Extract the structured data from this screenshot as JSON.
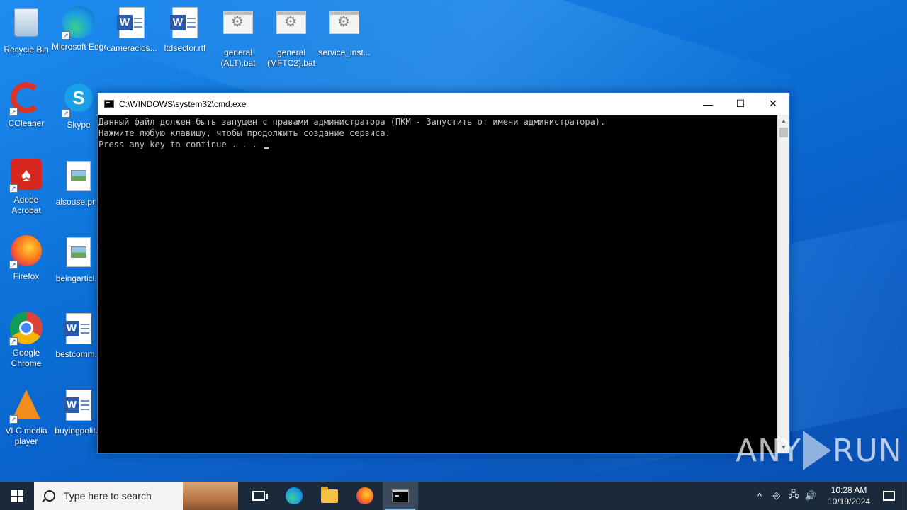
{
  "desktop_icons": [
    {
      "id": "recycle-bin",
      "label": "Recycle Bin"
    },
    {
      "id": "microsoft-edge",
      "label": "Microsoft Edge"
    },
    {
      "id": "cameraclos",
      "label": "cameraclos..."
    },
    {
      "id": "ltdsector",
      "label": "ltdsector.rtf"
    },
    {
      "id": "general-alt",
      "label": "general (ALT).bat"
    },
    {
      "id": "general-mgtc2",
      "label": "general (MFTC2).bat"
    },
    {
      "id": "service-inst",
      "label": "service_inst..."
    },
    {
      "id": "ccleaner",
      "label": "CCleaner"
    },
    {
      "id": "skype",
      "label": "Skype"
    },
    {
      "id": "adobe-acrobat",
      "label": "Adobe Acrobat"
    },
    {
      "id": "alsouse",
      "label": "alsouse.png"
    },
    {
      "id": "firefox",
      "label": "Firefox"
    },
    {
      "id": "beingarticl",
      "label": "beingarticl..."
    },
    {
      "id": "google-chrome",
      "label": "Google Chrome"
    },
    {
      "id": "bestcomm",
      "label": "bestcomm..."
    },
    {
      "id": "vlc",
      "label": "VLC media player"
    },
    {
      "id": "buyingpolit",
      "label": "buyingpolit..."
    }
  ],
  "cmd_window": {
    "title": "C:\\WINDOWS\\system32\\cmd.exe",
    "minimize": "—",
    "maximize": "☐",
    "close": "✕",
    "lines": [
      "Данный файл должен быть запущен с правами администратора (ПКМ - Запустить от имени администратора).",
      "Нажмите любую клавишу, чтобы продолжить создание сервиса.",
      "Press any key to continue . . . "
    ],
    "scroll_up": "▲",
    "scroll_down": "▼"
  },
  "watermark": {
    "left": "ANY",
    "right": "RUN"
  },
  "taskbar": {
    "search_placeholder": "Type here to search",
    "clock_time": "10:28 AM",
    "clock_date": "10/19/2024",
    "tray_chevron": "^",
    "tray_network": "🖧",
    "tray_volume": "🔊",
    "tray_meet": "⎆"
  },
  "colors": {
    "desktop_blue": "#0a6fd6",
    "taskbar": "#1b2a3a",
    "console_text": "#c0c0c0",
    "active_indicator": "#76b9ed"
  }
}
